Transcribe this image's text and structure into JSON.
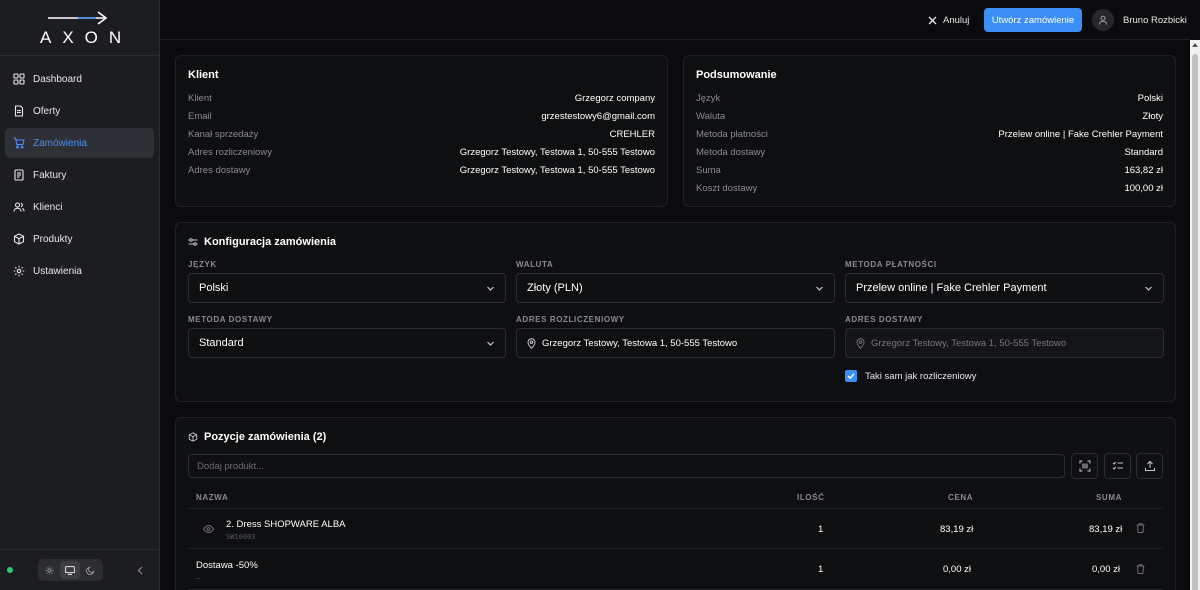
{
  "brand": {
    "logo_text": "AXON"
  },
  "sidebar": {
    "items": [
      {
        "label": "Dashboard",
        "icon": "dashboard-icon"
      },
      {
        "label": "Oferty",
        "icon": "document-icon"
      },
      {
        "label": "Zamówienia",
        "icon": "cart-icon",
        "active": true
      },
      {
        "label": "Faktury",
        "icon": "invoice-icon"
      },
      {
        "label": "Klienci",
        "icon": "users-icon"
      },
      {
        "label": "Produkty",
        "icon": "box-icon"
      },
      {
        "label": "Ustawienia",
        "icon": "gear-icon"
      }
    ]
  },
  "header": {
    "cancel_label": "Anuluj",
    "create_label": "Utwórz zamówienie",
    "user_name": "Bruno Rozbicki"
  },
  "client": {
    "title": "Klient",
    "rows": [
      {
        "label": "Klient",
        "value": "Grzegorz company"
      },
      {
        "label": "Email",
        "value": "grzestestowy6@gmail.com"
      },
      {
        "label": "Kanał sprzedaży",
        "value": "CREHLER"
      },
      {
        "label": "Adres rozliczeniowy",
        "value": "Grzegorz Testowy, Testowa 1, 50-555 Testowo"
      },
      {
        "label": "Adres dostawy",
        "value": "Grzegorz Testowy, Testowa 1, 50-555 Testowo"
      }
    ]
  },
  "summary": {
    "title": "Podsumowanie",
    "rows": [
      {
        "label": "Język",
        "value": "Polski"
      },
      {
        "label": "Waluta",
        "value": "Złoty"
      },
      {
        "label": "Metoda płatności",
        "value": "Przelew online | Fake Crehler Payment"
      },
      {
        "label": "Metoda dostawy",
        "value": "Standard"
      },
      {
        "label": "Suma",
        "value": "163,82 zł"
      },
      {
        "label": "Koszt dostawy",
        "value": "100,00 zł"
      }
    ]
  },
  "config": {
    "title": "Konfiguracja zamówienia",
    "language": {
      "label": "JĘZYK",
      "value": "Polski"
    },
    "currency": {
      "label": "WALUTA",
      "value": "Złoty (PLN)"
    },
    "payment": {
      "label": "METODA PŁATNOŚCI",
      "value": "Przelew online | Fake Crehler Payment"
    },
    "shipping": {
      "label": "METODA DOSTAWY",
      "value": "Standard"
    },
    "billing_address": {
      "label": "ADRES ROZLICZENIOWY",
      "value": "Grzegorz Testowy, Testowa 1, 50-555 Testowo"
    },
    "delivery_address": {
      "label": "ADRES DOSTAWY",
      "value": "Grzegorz Testowy, Testowa 1, 50-555 Testowo"
    },
    "same_as_billing": {
      "label": "Taki sam jak rozliczeniowy",
      "checked": true
    }
  },
  "positions": {
    "title": "Pozycje zamówienia (2)",
    "add_placeholder": "Dodaj produkt...",
    "columns": {
      "name": "NAZWA",
      "qty": "ILOŚĆ",
      "price": "CENA",
      "sum": "SUMA"
    },
    "rows": [
      {
        "name": "2. Dress SHOPWARE ALBA",
        "sku": "SW10003",
        "qty": "1",
        "price": "83,19 zł",
        "sum": "83,19 zł"
      },
      {
        "name": "Dostawa -50%",
        "sku": "–",
        "qty": "1",
        "price": "0,00 zł",
        "sum": "0,00 zł"
      }
    ]
  },
  "colors": {
    "accent": "#3b8ef5",
    "online": "#2ecc71"
  }
}
